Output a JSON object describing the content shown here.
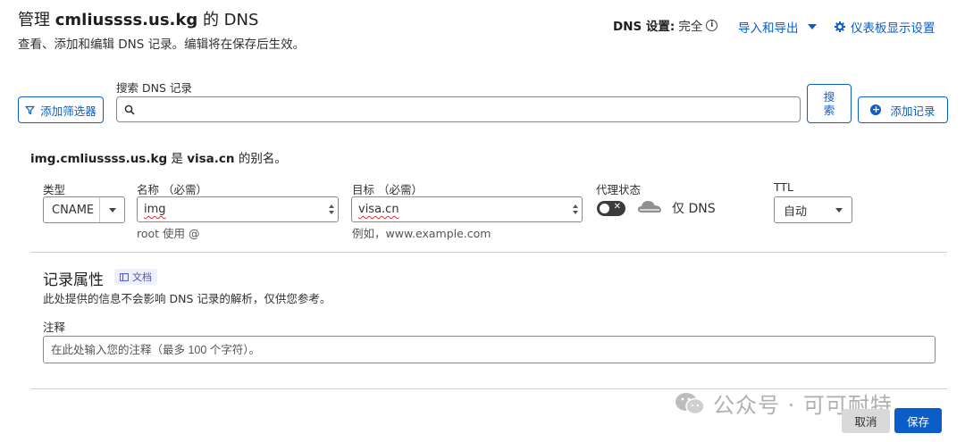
{
  "header": {
    "title_prefix": "管理 ",
    "title_domain": "cmliussss.us.kg",
    "title_suffix": " 的 DNS",
    "subtitle": "查看、添加和编辑 DNS 记录。编辑将在保存后生效。",
    "dns_settings_label": "DNS 设置:",
    "dns_settings_value": "完全",
    "import_export": "导入和导出",
    "dashboard_settings": "仪表板显示设置"
  },
  "search": {
    "label": "搜索 DNS 记录",
    "value": "",
    "filter_button": "添加筛选器",
    "search_button_line1": "搜",
    "search_button_line2": "索",
    "add_record_button": "添加记录"
  },
  "alias": {
    "host": "img.cmliussss.us.kg",
    "is": " 是 ",
    "target": "visa.cn",
    "suffix": " 的别名。"
  },
  "record": {
    "type_label": "类型",
    "type_value": "CNAME",
    "name_label": "名称 （必需）",
    "name_value": "img",
    "name_hint": "root 使用 @",
    "target_label": "目标 （必需）",
    "target_value": "visa.cn",
    "target_hint": "例如，www.example.com",
    "proxy_label": "代理状态",
    "proxy_value": "仅 DNS",
    "ttl_label": "TTL",
    "ttl_value": "自动"
  },
  "attributes": {
    "title": "记录属性",
    "doc_badge": "文档",
    "description": "此处提供的信息不会影响 DNS 记录的解析，仅供您参考。",
    "comment_label": "注释",
    "comment_placeholder": "在此处输入您的注释（最多 100 个字符）。"
  },
  "footer": {
    "cancel": "取消",
    "save": "保存"
  },
  "watermark": {
    "text": "公众号 · 可可耐特"
  },
  "colors": {
    "accent": "#0b5ec9",
    "toggle_off": "#3c3c3c",
    "badge_bg": "#eef0fb"
  },
  "icons": [
    "filter-icon",
    "search-icon",
    "plus-circle-icon",
    "info-icon",
    "gear-icon",
    "cloud-icon",
    "doc-icon",
    "wechat-icon"
  ]
}
